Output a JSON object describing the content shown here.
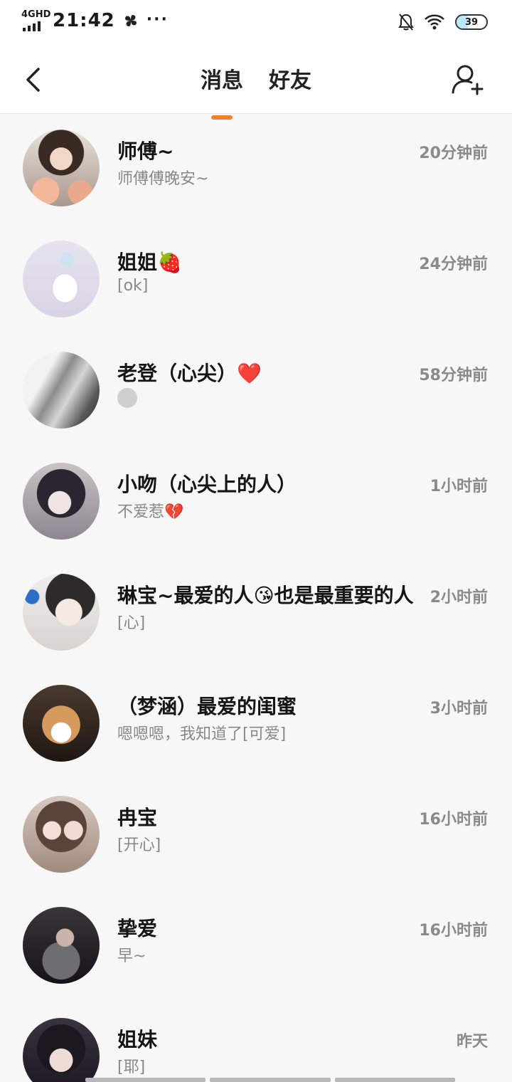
{
  "status_bar": {
    "network": "4GHD",
    "time": "21:42",
    "more": "···",
    "battery": "39",
    "battery_level": 0.39,
    "icons": [
      "mute-bell-icon",
      "wifi-icon",
      "battery-icon"
    ]
  },
  "header": {
    "tabs": [
      {
        "label": "消息",
        "active": true
      },
      {
        "label": "好友",
        "active": false
      }
    ],
    "accent_color": "#f57f2a",
    "icons": [
      "back-arrow-icon",
      "add-friend-icon"
    ]
  },
  "messages": [
    {
      "name": "师傅~",
      "preview": "师傅傅晚安~",
      "time": "20分钟前"
    },
    {
      "name": "姐姐🍓",
      "preview": "[ok]",
      "time": "24分钟前"
    },
    {
      "name": "老登（心尖）❤️",
      "preview": "",
      "time": "58分钟前"
    },
    {
      "name": "小吻（心尖上的人）",
      "preview": "不爱惹💔",
      "time": "1小时前"
    },
    {
      "name": "琳宝~最爱的人😘也是最重要的人",
      "preview": "[心]",
      "time": "2小时前"
    },
    {
      "name": "（梦涵）最爱的闺蜜",
      "preview": "嗯嗯嗯，我知道了[可爱]",
      "time": "3小时前"
    },
    {
      "name": "冉宝",
      "preview": "[开心]",
      "time": "16小时前"
    },
    {
      "name": "挚爱",
      "preview": "早~",
      "time": "16小时前"
    },
    {
      "name": "姐妹",
      "preview": "[耶]",
      "time": "昨天"
    }
  ]
}
